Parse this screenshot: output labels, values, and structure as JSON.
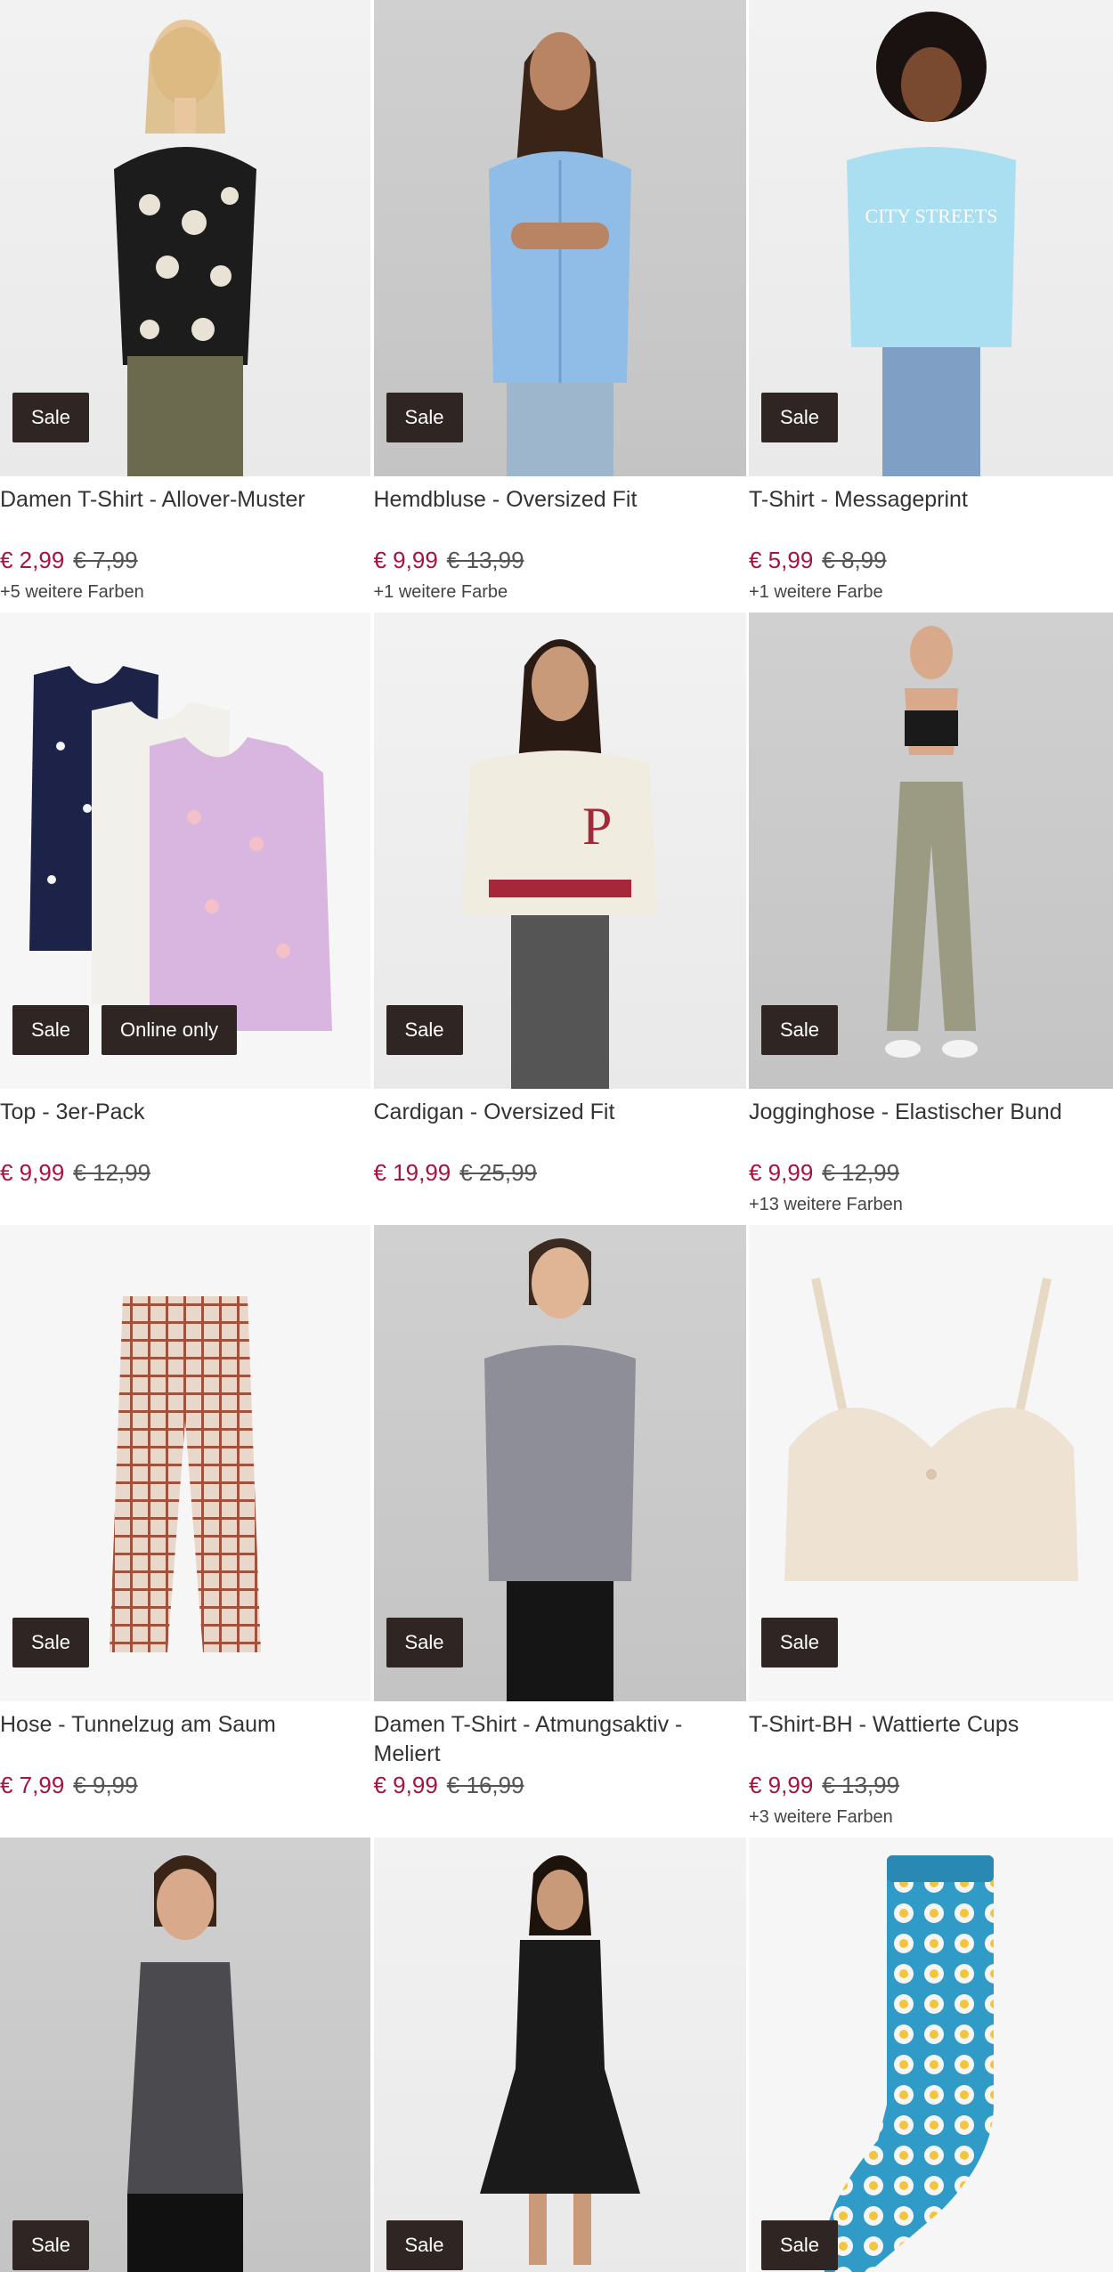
{
  "products": [
    {
      "title": "Damen T-Shirt - Allover-Muster",
      "badges": [
        "Sale"
      ],
      "price": "€ 2,99",
      "old_price": "€ 7,99",
      "colors": "+5 weitere Farben"
    },
    {
      "title": "Hemdbluse - Oversized Fit",
      "badges": [
        "Sale"
      ],
      "price": "€ 9,99",
      "old_price": "€ 13,99",
      "colors": "+1 weitere Farbe"
    },
    {
      "title": "T-Shirt - Messageprint",
      "badges": [
        "Sale"
      ],
      "price": "€ 5,99",
      "old_price": "€ 8,99",
      "colors": "+1 weitere Farbe"
    },
    {
      "title": "Top - 3er-Pack",
      "badges": [
        "Sale",
        "Online only"
      ],
      "price": "€ 9,99",
      "old_price": "€ 12,99",
      "colors": ""
    },
    {
      "title": "Cardigan - Oversized Fit",
      "badges": [
        "Sale"
      ],
      "price": "€ 19,99",
      "old_price": "€ 25,99",
      "colors": ""
    },
    {
      "title": "Jogginghose - Elastischer Bund",
      "badges": [
        "Sale"
      ],
      "price": "€ 9,99",
      "old_price": "€ 12,99",
      "colors": "+13 weitere Farben"
    },
    {
      "title": "Hose - Tunnelzug am Saum",
      "badges": [
        "Sale"
      ],
      "price": "€ 7,99",
      "old_price": "€ 9,99",
      "colors": ""
    },
    {
      "title": "Damen T-Shirt - Atmungsaktiv - Meliert",
      "badges": [
        "Sale"
      ],
      "price": "€ 9,99",
      "old_price": "€ 16,99",
      "colors": ""
    },
    {
      "title": "T-Shirt-BH - Wattierte Cups",
      "badges": [
        "Sale"
      ],
      "price": "€ 9,99",
      "old_price": "€ 13,99",
      "colors": "+3 weitere Farben"
    },
    {
      "badges": [
        "Sale"
      ]
    },
    {
      "badges": [
        "Sale"
      ]
    },
    {
      "badges": [
        "Sale"
      ]
    }
  ],
  "colors": {
    "sale_price": "#a4143f",
    "badge_bg": "#2f2624"
  }
}
